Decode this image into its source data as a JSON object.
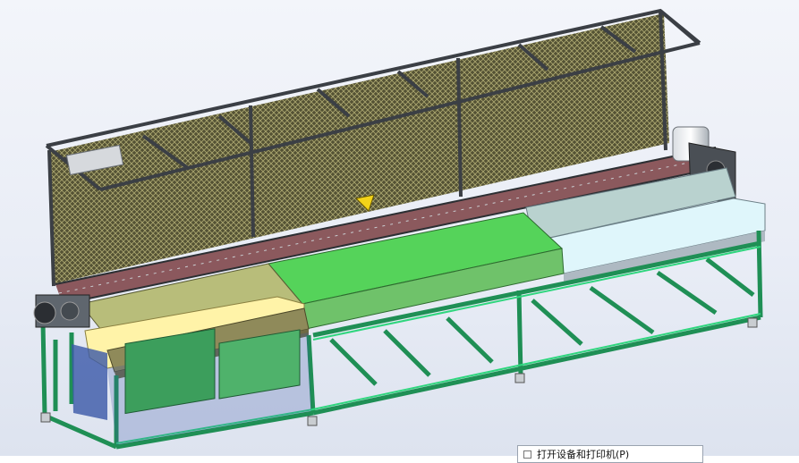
{
  "viewport": {
    "background": "#e9edf6"
  },
  "model": {
    "kind": "3D CAD assembly render",
    "colors": {
      "frame_green": "#2fd67e",
      "frame_dark": "#1f8f55",
      "fence_frame": "#3b3f45",
      "mesh_fill": "#4c4a2a",
      "yellow_cover": "#fff3a8",
      "olive_cover": "#b8bd7a",
      "brown_cover": "#8f8a5a",
      "bright_green_cover": "#55d35a",
      "green_cover": "#6fc26a",
      "grey_cover": "#b9d2cf",
      "lightblue_cover": "#dff6fb",
      "steel_grey": "#5f666e",
      "blue_panel": "#3a58a8",
      "glass_green": "#3c9e5c",
      "yellow_bracket": "#f3d31a"
    }
  },
  "tooltip": {
    "icon": "checkbox-icon",
    "label": "打开设备和打印机(P)"
  }
}
